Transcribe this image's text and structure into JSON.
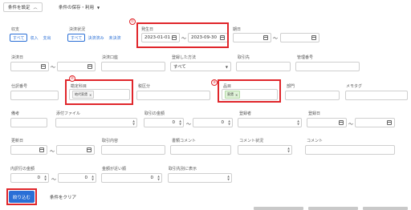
{
  "header": {
    "settings_tab": "条件を設定",
    "save_tab": "条件の保存・利用"
  },
  "row1": {
    "income_label": "収支",
    "income_options": [
      "すべて",
      "収入",
      "支出"
    ],
    "settle_label": "決済状況",
    "settle_options": [
      "すべて",
      "決済済み",
      "未決済"
    ],
    "occur_label": "発生日",
    "occur_from": "2023-01-01",
    "occur_to": "2023-09-30",
    "due_label": "期日",
    "tilde": "〜"
  },
  "row2": {
    "settle_date_label": "決済日",
    "settle_account_label": "決済口座",
    "method_label": "登録した方法",
    "method_value": "すべて",
    "partner_label": "取引先",
    "manage_label": "管理番号"
  },
  "row3": {
    "invoice_label": "仕訳番号",
    "account_label": "勘定科目",
    "account_tag": "地代家賃",
    "tax_label": "税区分",
    "item_label": "品目",
    "item_tag": "家賃",
    "dept_label": "部門",
    "memo_label": "メモタグ"
  },
  "row4": {
    "note_label": "備考",
    "attach_label": "添付ファイル",
    "amount_label": "取引の金額",
    "amount_from": "0",
    "amount_to": "0",
    "registrant_label": "登録者",
    "reg_date_label": "登録日"
  },
  "row5": {
    "update_label": "更新日",
    "content_label": "取引内容",
    "receipt_comment_label": "書類コメント",
    "comment_status_label": "コメント状況",
    "comment_label": "コメント"
  },
  "row6": {
    "tax_amount_label": "内訳行の金額",
    "tax_from": "0",
    "tax_to": "0",
    "near_amount_label": "金額が近い順",
    "near_value": "0",
    "show_label": "取引先別に表示"
  },
  "annotations": [
    "①",
    "②",
    "③"
  ],
  "footer": {
    "apply_label": "絞り込む",
    "clear_label": "条件をクリア"
  },
  "colors": {
    "accent": "#2a6fd6",
    "annotation": "#e0262b"
  }
}
